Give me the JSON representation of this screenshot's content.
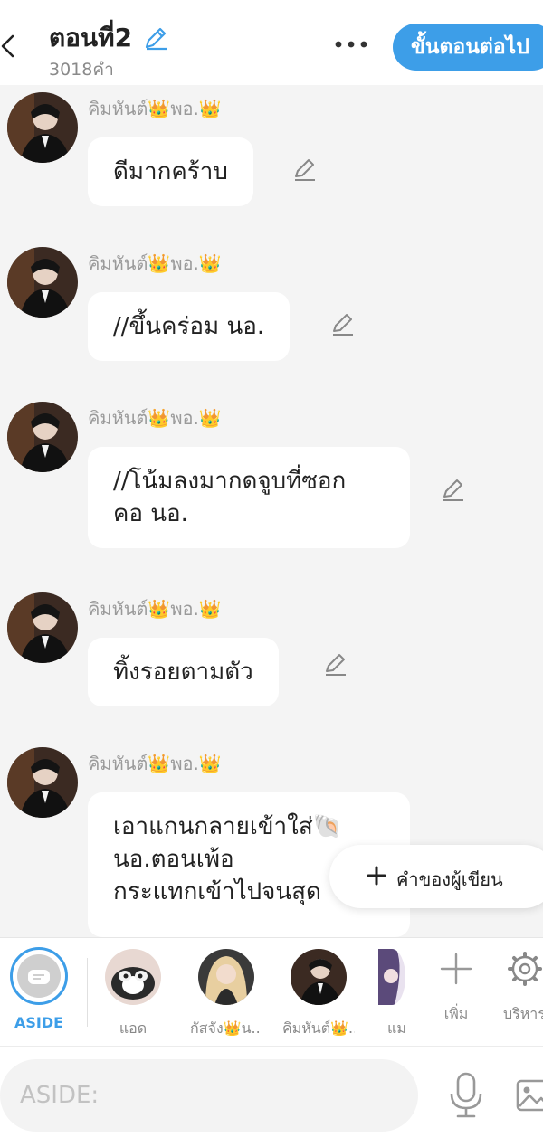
{
  "header": {
    "title": "ตอนที่2",
    "word_count": "3018คำ",
    "next_button": "ขั้นตอนต่อไป"
  },
  "messages": [
    {
      "author": "คิมหันต์",
      "author_suffix": "พอ.",
      "crown": "👑",
      "text": "ดีมากคร้าบ"
    },
    {
      "author": "คิมหันต์",
      "author_suffix": "พอ.",
      "crown": "👑",
      "text": "//ขึ้นคร่อม นอ."
    },
    {
      "author": "คิมหันต์",
      "author_suffix": "พอ.",
      "crown": "👑",
      "text": "//โน้มลงมากดจูบที่ซอก\nคอ  นอ."
    },
    {
      "author": "คิมหันต์",
      "author_suffix": "พอ.",
      "crown": "👑",
      "text": "ทิ้งรอยตามตัว"
    },
    {
      "author": "คิมหันต์",
      "author_suffix": "พอ.",
      "crown": "👑",
      "text": "เอาแกนกลายเข้าใส่🐚\nนอ.ตอนเพ้อ\nกระแทกเข้าไปจนสุด"
    }
  ],
  "author_words_button": "คำของผู้เขียน",
  "characters": {
    "aside": "ASIDE",
    "items": [
      {
        "label": "แอด"
      },
      {
        "label": "กัสจัง👑น..."
      },
      {
        "label": "คิมหันต์👑..."
      },
      {
        "label": "แม"
      }
    ],
    "add_label": "เพิ่ม",
    "manage_label": "บริหาร"
  },
  "input": {
    "placeholder": "ASIDE:",
    "value": ""
  },
  "colors": {
    "accent": "#3d9ee8",
    "bubble": "#ffffff",
    "background": "#f4f4f4"
  }
}
